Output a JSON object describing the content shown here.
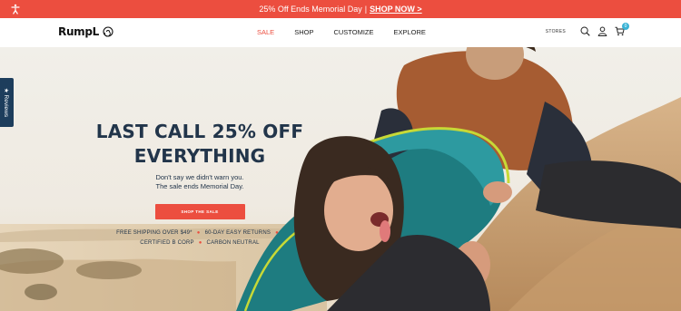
{
  "promo": {
    "text": "25% Off Ends Memorial Day",
    "separator": "|",
    "link": "SHOP NOW >"
  },
  "header": {
    "logo": "RumpL",
    "nav": [
      "SALE",
      "SHOP",
      "CUSTOMIZE",
      "EXPLORE"
    ],
    "stores": "STORES",
    "cart_count": "0"
  },
  "hero": {
    "headline_line1": "LAST CALL 25% OFF",
    "headline_line2": "EVERYTHING",
    "sub_line1": "Don't say we didn't warn you.",
    "sub_line2": "The sale ends Memorial Day.",
    "cta": "SHOP THE SALE",
    "perk1": "FREE SHIPPING OVER $49*",
    "perk2": "60-DAY EASY RETURNS",
    "perk3": "CERTIFIED B CORP",
    "perk4": "CARBON NEUTRAL"
  },
  "reviews_tab": {
    "label": "★ Reviews"
  },
  "colors": {
    "accent": "#ec4e3f",
    "navy": "#22354a",
    "cart_badge": "#3ab3d6",
    "reviews_tab": "#1d3d5c"
  }
}
